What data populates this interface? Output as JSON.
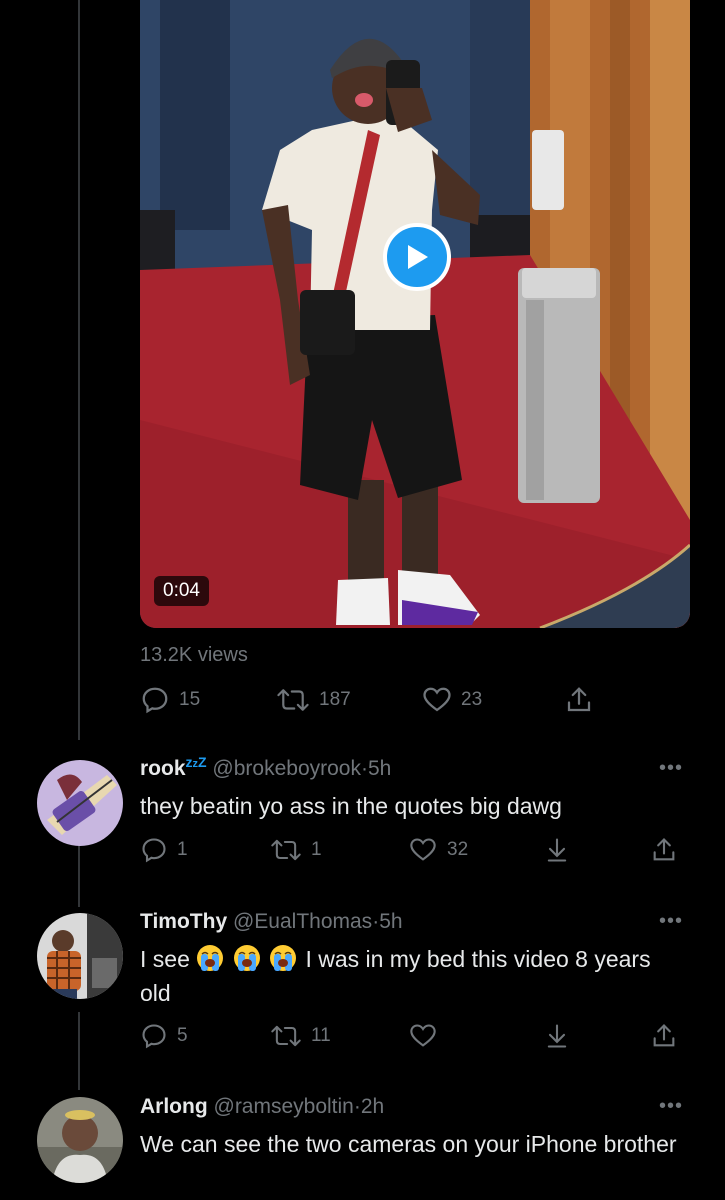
{
  "tweet": {
    "video_duration": "0:04",
    "views": "13.2K views",
    "stats": {
      "replies": "15",
      "retweets": "187",
      "likes": "23"
    }
  },
  "replies": [
    {
      "display_name": "rook",
      "handle": "@brokeboyrook",
      "separator": "·",
      "time": "5h",
      "text": "they beatin yo ass in the quotes big dawg",
      "stats": {
        "replies": "1",
        "retweets": "1",
        "likes": "32"
      }
    },
    {
      "display_name": "TimoThy",
      "handle": "@EualThomas",
      "separator": "·",
      "time": "5h",
      "text_before": "I see",
      "text_after": "I was in my bed this video 8 years old",
      "stats": {
        "replies": "5",
        "retweets": "11",
        "likes": ""
      }
    },
    {
      "display_name": "Arlong",
      "handle": "@ramseyboltin",
      "separator": "·",
      "time": "2h",
      "text": "We can see the two cameras on your iPhone brother"
    }
  ],
  "icons": {
    "reply": "reply-icon",
    "retweet": "retweet-icon",
    "like": "heart-icon",
    "share": "share-icon",
    "bookmark": "download-icon",
    "more": "more-icon",
    "play": "play-icon",
    "emoji": "loudly-crying-face-emoji",
    "sleeping": "zzz-emoji"
  },
  "colors": {
    "background": "#000000",
    "text": "#e7e9ea",
    "secondary": "#71767b",
    "accent": "#1d9bf0"
  }
}
